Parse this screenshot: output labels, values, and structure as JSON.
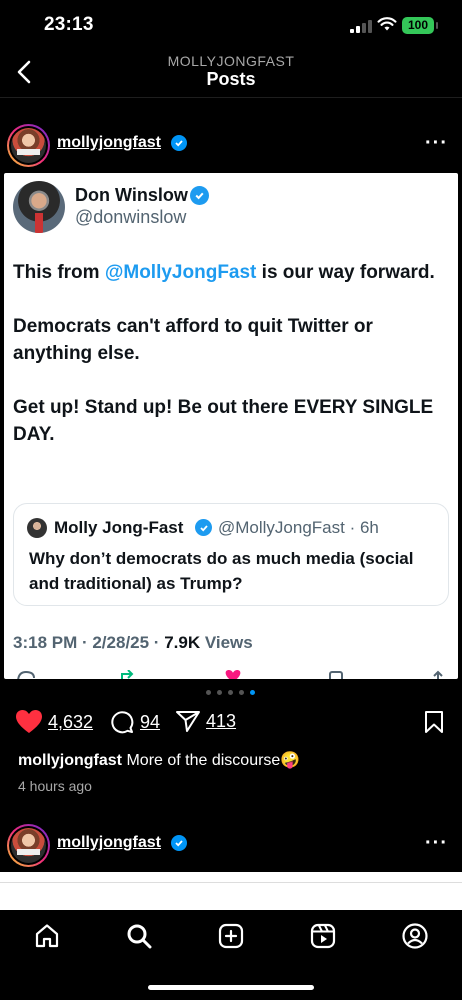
{
  "status": {
    "time": "23:13",
    "battery": "100"
  },
  "header": {
    "subtitle": "MOLLYJONGFAST",
    "title": "Posts"
  },
  "post": {
    "username": "mollyjongfast",
    "tweet": {
      "name": "Don Winslow",
      "handle": "@donwinslow",
      "body_p1_pre": "This from ",
      "body_p1_mention": "@MollyJongFast",
      "body_p1_post": " is our way forward.",
      "body_p2": "Democrats can't afford to quit Twitter or anything else.",
      "body_p3": "Get up! Stand up! Be out there EVERY SINGLE DAY.",
      "quote": {
        "name": "Molly Jong-Fast",
        "handle": "@MollyJongFast · 6h",
        "text": "Why don’t democrats do as much media (social and traditional) as Trump?"
      },
      "meta_time": "3:18 PM · 2/28/25 · ",
      "meta_views": "7.9K",
      "meta_views_label": " Views"
    },
    "likes": "4,632",
    "comments": "94",
    "shares": "413",
    "caption_user": "mollyjongfast",
    "caption_text": " More of the discourse",
    "caption_emoji": "🤪",
    "time_ago": "4 hours ago",
    "carousel": {
      "count": 5,
      "active": 4
    }
  },
  "next_post": {
    "username": "mollyjongfast"
  },
  "tabs": [
    "home",
    "search",
    "create",
    "reels",
    "profile"
  ],
  "colors": {
    "accent": "#0095f6",
    "like": "#ff3040",
    "twitter_blue": "#1d9bf0"
  }
}
